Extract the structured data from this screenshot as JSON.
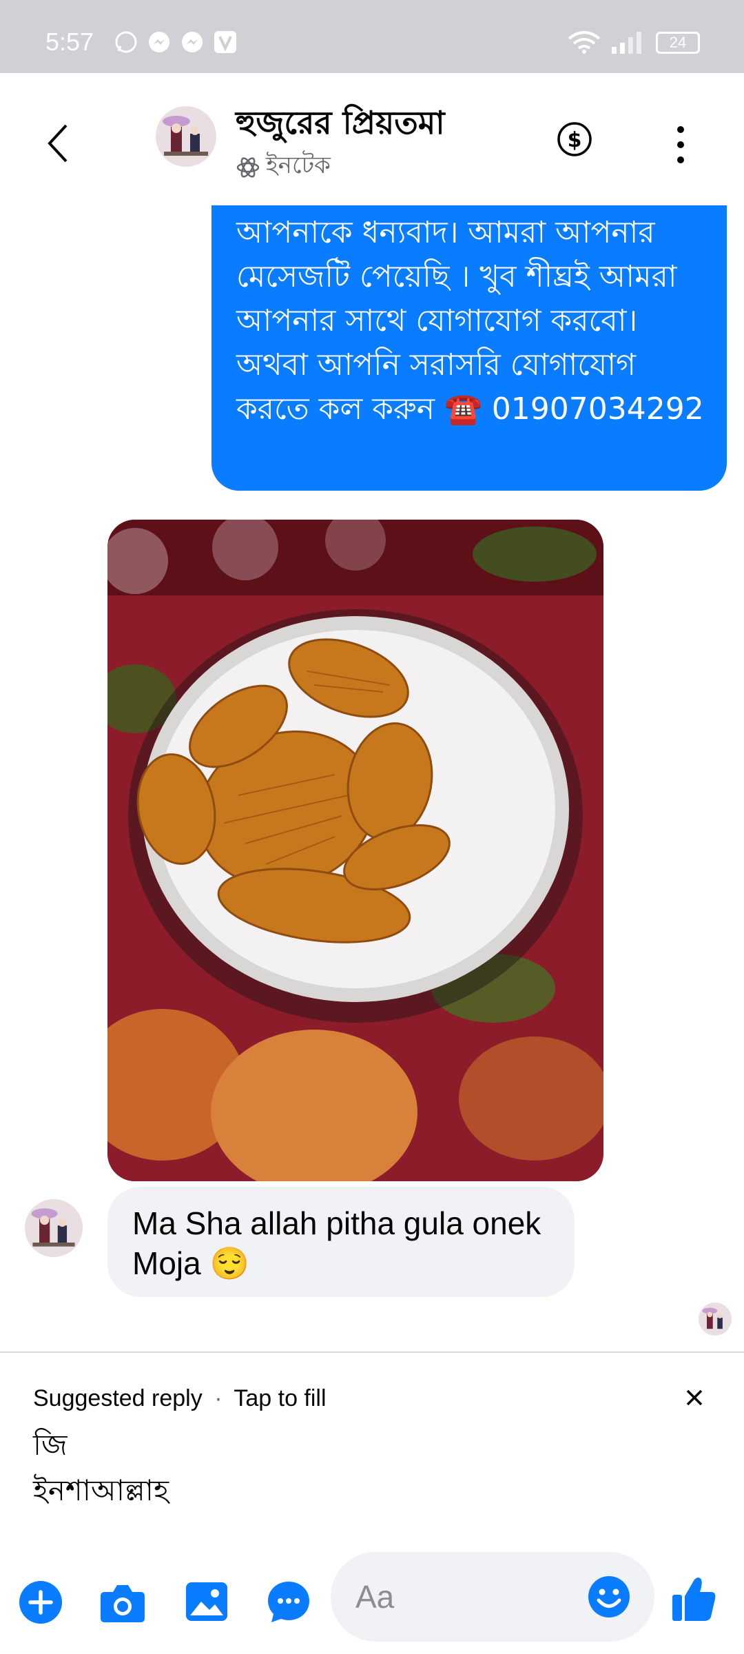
{
  "status_bar": {
    "time": "5:57",
    "battery": "24"
  },
  "header": {
    "title": "হুজুরের প্রিয়তমা",
    "subtitle": "ইনটেক"
  },
  "messages": {
    "outgoing_text": "আপনাকে ধন্যবাদ। আমরা আপনার মেসেজটি পেয়েছি । খুব শীঘ্রই আমরা আপনার সাথে যোগাযোগ করবো। অথবা আপনি সরাসরি যোগাযোগ করতে কল করুন ☎️ 01907034292",
    "incoming_text": "Ma Sha allah pitha gula onek Moja 😌"
  },
  "suggested": {
    "label": "Suggested reply",
    "separator": "·",
    "hint": "Tap to fill",
    "items": [
      "জি",
      "ইনশাআল্লাহ"
    ]
  },
  "composer": {
    "placeholder": "Aa"
  },
  "colors": {
    "accent": "#0a7cff",
    "status_bar": "#d0d1d5",
    "incoming_bubble": "#f0f2f5"
  }
}
